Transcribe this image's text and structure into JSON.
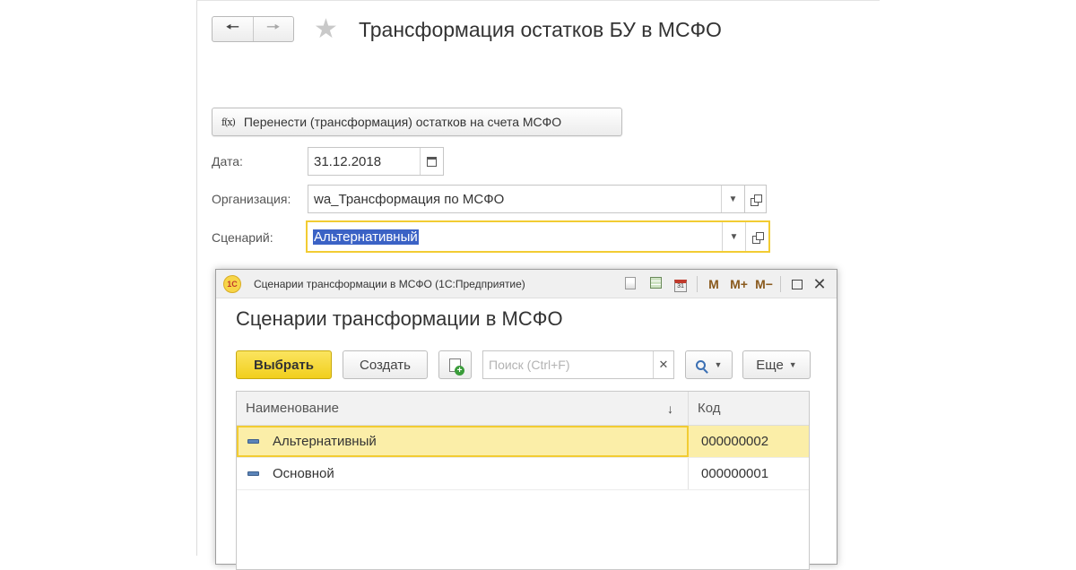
{
  "header": {
    "back_icon": "arrow-left-icon",
    "forward_icon": "arrow-right-icon",
    "favorite_icon": "star-icon",
    "title": "Трансформация остатков БУ в МСФО"
  },
  "command": {
    "icon_text": "f(x)",
    "label": "Перенести (трансформация) остатков на счета МСФО"
  },
  "form": {
    "date": {
      "label": "Дата:",
      "value": "31.12.2018"
    },
    "organization": {
      "label": "Организация:",
      "value": "wa_Трансформация по МСФО"
    },
    "scenario": {
      "label": "Сценарий:",
      "value": "Альтернативный"
    }
  },
  "dialog": {
    "window_title": "Сценарии трансформации в МСФО  (1С:Предприятие)",
    "logo_text": "1С",
    "toolbar_icons": {
      "m": "M",
      "m_plus": "M+",
      "m_minus": "M−",
      "cal": "31"
    },
    "heading": "Сценарии трансформации в МСФО",
    "buttons": {
      "select": "Выбрать",
      "create": "Создать",
      "more": "Еще"
    },
    "search": {
      "placeholder": "Поиск (Ctrl+F)",
      "value": ""
    },
    "table": {
      "columns": [
        "Наименование",
        "Код"
      ],
      "rows": [
        {
          "name": "Альтернативный",
          "code": "000000002",
          "selected": true
        },
        {
          "name": "Основной",
          "code": "000000001",
          "selected": false
        }
      ]
    }
  },
  "colors": {
    "accent_yellow": "#f2cc33",
    "primary_button": "#f5d530",
    "selection_blue": "#3b62c5",
    "selected_row": "#fbeea8"
  }
}
